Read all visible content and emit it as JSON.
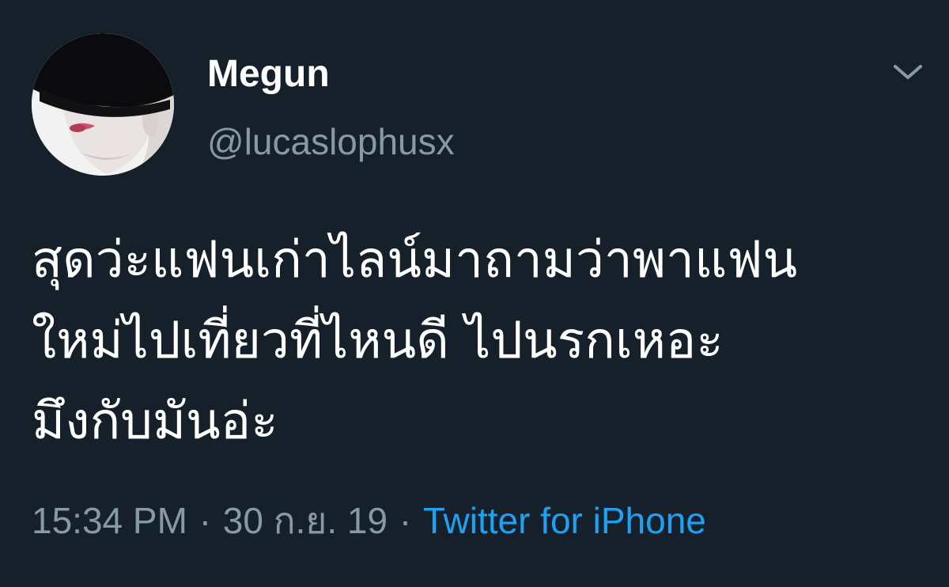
{
  "tweet": {
    "display_name": "Megun",
    "handle": "@lucaslophusx",
    "text_lines": [
      "สุดว่ะแฟนเก่าไลน์มาถามว่าพาแฟน",
      "ใหม่ไปเที่ยวที่ไหนดี ไปนรกเหอะ",
      "มึงกับมันอ่ะ"
    ],
    "time": "15:34 PM",
    "separator": "·",
    "date": "30 ก.ย. 19",
    "source": "Twitter for iPhone"
  },
  "icons": {
    "menu": "chevron-down-icon"
  },
  "colors": {
    "background": "#15202b",
    "primary_text": "#ffffff",
    "secondary_text": "#8899a6",
    "link": "#1da1f2"
  }
}
